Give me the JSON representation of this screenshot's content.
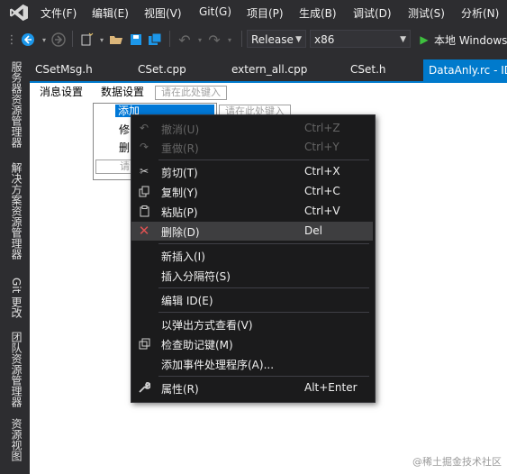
{
  "menubar": {
    "items": [
      "文件(F)",
      "编辑(E)",
      "视图(V)",
      "Git(G)",
      "项目(P)",
      "生成(B)",
      "调试(D)",
      "测试(S)",
      "分析(N)"
    ]
  },
  "toolbar": {
    "configuration": "Release",
    "platform": "x86",
    "run_target": "本地 Windows"
  },
  "sidebar": {
    "tabs": [
      "服务器资源管理器",
      "解决方案资源管理器",
      "Git 更改",
      "团队资源管理器",
      "资源视图"
    ]
  },
  "doc_tabs": {
    "items": [
      "CSetMsg.h",
      "CSet.cpp",
      "extern_all.cpp",
      "CSet.h"
    ],
    "active": "DataAnly.rc - ID"
  },
  "resource_menu": {
    "items": [
      "消息设置",
      "数据设置"
    ],
    "type_here": "请在此处键入",
    "sub_items": [
      "添加",
      "修",
      "删",
      "请"
    ],
    "sub_type_here": "请在此处键入"
  },
  "context_menu": {
    "undo": {
      "label": "撤消(U)",
      "shortcut": "Ctrl+Z"
    },
    "redo": {
      "label": "重做(R)",
      "shortcut": "Ctrl+Y"
    },
    "cut": {
      "label": "剪切(T)",
      "shortcut": "Ctrl+X"
    },
    "copy": {
      "label": "复制(Y)",
      "shortcut": "Ctrl+C"
    },
    "paste": {
      "label": "粘贴(P)",
      "shortcut": "Ctrl+V"
    },
    "delete": {
      "label": "删除(D)",
      "shortcut": "Del"
    },
    "new_insert": {
      "label": "新插入(I)"
    },
    "insert_separator": {
      "label": "插入分隔符(S)"
    },
    "edit_id": {
      "label": "编辑 ID(E)"
    },
    "popup_view": {
      "label": "以弹出方式查看(V)"
    },
    "check_mnemonics": {
      "label": "检查助记键(M)"
    },
    "add_event_handler": {
      "label": "添加事件处理程序(A)..."
    },
    "properties": {
      "label": "属性(R)",
      "shortcut": "Alt+Enter"
    }
  },
  "watermark": "@稀土掘金技术社区",
  "colors": {
    "accent": "#007acc",
    "delete_icon": "#e05252",
    "background": "#2d2d30"
  }
}
